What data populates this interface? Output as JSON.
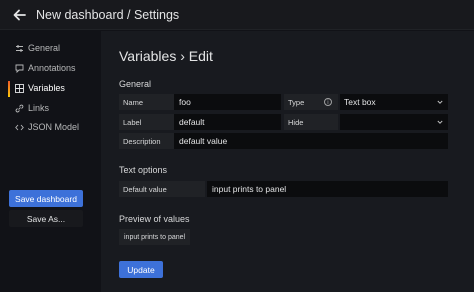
{
  "header": {
    "title": "New dashboard / Settings",
    "back_icon": "arrow-left-icon"
  },
  "sidebar": {
    "items": [
      {
        "label": "General",
        "icon": "sliders-icon",
        "active": false
      },
      {
        "label": "Annotations",
        "icon": "comment-icon",
        "active": false
      },
      {
        "label": "Variables",
        "icon": "calculator-icon",
        "active": true
      },
      {
        "label": "Links",
        "icon": "link-icon",
        "active": false
      },
      {
        "label": "JSON Model",
        "icon": "code-icon",
        "active": false
      }
    ],
    "save_label": "Save dashboard",
    "save_as_label": "Save As..."
  },
  "main": {
    "title": "Variables › Edit",
    "general": {
      "heading": "General",
      "name_label": "Name",
      "name_value": "foo",
      "type_label": "Type",
      "type_value": "Text box",
      "label_label": "Label",
      "label_value": "default",
      "hide_label": "Hide",
      "hide_value": "",
      "description_label": "Description",
      "description_value": "default value"
    },
    "text_options": {
      "heading": "Text options",
      "default_value_label": "Default value",
      "default_value": "input prints to panel"
    },
    "preview": {
      "heading": "Preview of values",
      "values": [
        "input prints to panel"
      ]
    },
    "update_label": "Update"
  },
  "colors": {
    "primary": "#3d71d9",
    "background": "#111217",
    "panel": "#181a1f"
  }
}
